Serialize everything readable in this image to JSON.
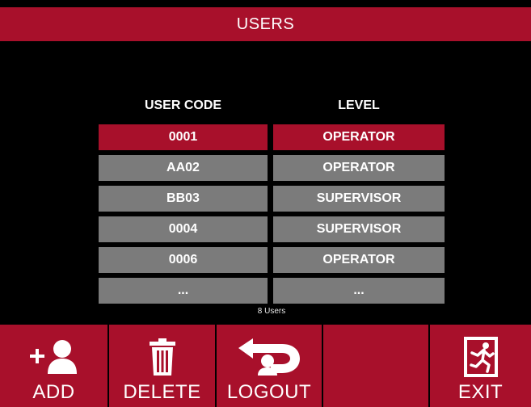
{
  "window": {
    "title": "USERS"
  },
  "table": {
    "headers": {
      "code": "USER CODE",
      "level": "LEVEL"
    },
    "rows": [
      {
        "code": "0001",
        "level": "OPERATOR",
        "selected": true
      },
      {
        "code": "AA02",
        "level": "OPERATOR",
        "selected": false
      },
      {
        "code": "BB03",
        "level": "SUPERVISOR",
        "selected": false
      },
      {
        "code": "0004",
        "level": "SUPERVISOR",
        "selected": false
      },
      {
        "code": "0006",
        "level": "OPERATOR",
        "selected": false
      },
      {
        "code": "...",
        "level": "...",
        "selected": false
      }
    ],
    "count_label": "8 Users"
  },
  "toolbar": {
    "add_label": "ADD",
    "delete_label": "DELETE",
    "logout_label": "LOGOUT",
    "exit_label": "EXIT",
    "icons": {
      "add": "add-user-icon",
      "delete": "trash-icon",
      "logout": "logout-arrow-icon",
      "exit": "exit-door-icon"
    }
  },
  "colors": {
    "accent": "#a8102b",
    "row_default": "#7b7b7b",
    "background": "#000000"
  }
}
